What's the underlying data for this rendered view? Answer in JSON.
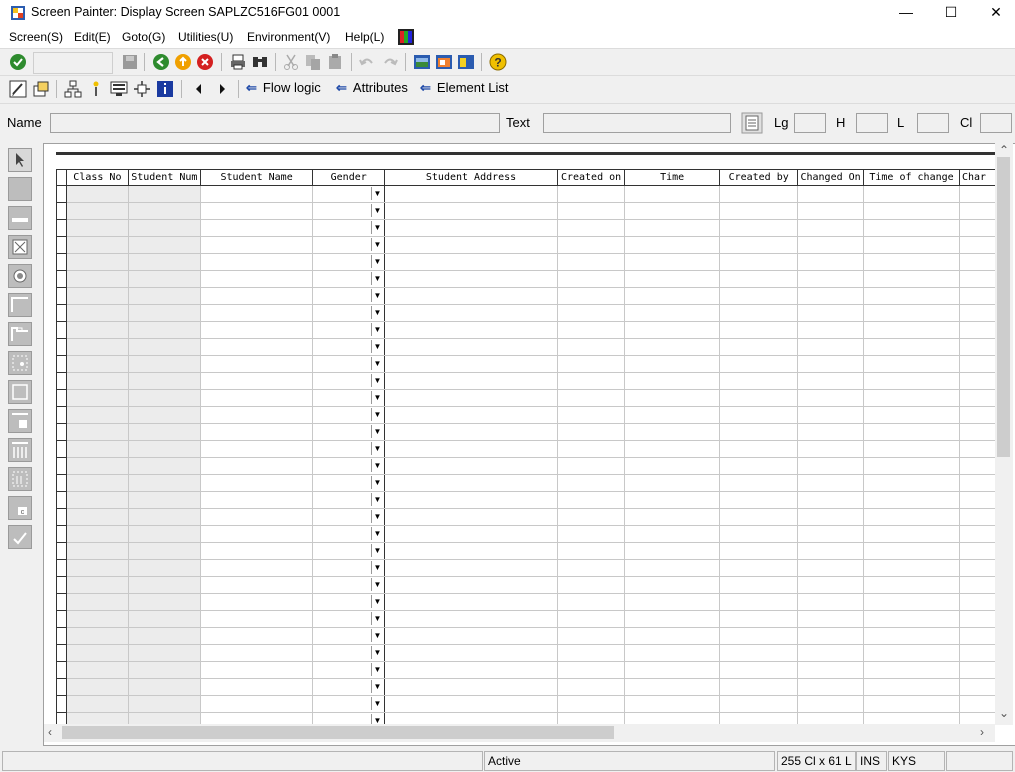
{
  "window": {
    "title": "Screen Painter:  Display Screen SAPLZC516FG01 0001",
    "minimize": "—",
    "maximize": "☐",
    "close": "✕"
  },
  "menu": [
    "Screen(S)",
    "Edit(E)",
    "Goto(G)",
    "Utilities(U)",
    "Environment(V)",
    "Help(L)"
  ],
  "nav": {
    "flow_logic": "Flow logic",
    "attributes": "Attributes",
    "element_list": "Element List"
  },
  "fields": {
    "name_label": "Name",
    "text_label": "Text",
    "lg_label": "Lg",
    "h_label": "H",
    "l_label": "L",
    "cl_label": "Cl"
  },
  "table": {
    "columns": [
      "Class No",
      "Student Num",
      "Student Name",
      "Gender",
      "Student Address",
      "Created on",
      "Time",
      "Created by",
      "Changed On",
      "Time of change",
      "Char"
    ],
    "row_count": 32
  },
  "status": {
    "state": "Active",
    "size": "255 Cl x 61 L",
    "mode": "INS",
    "keyboard": "KYS"
  },
  "colors": {
    "accent_blue": "#1f4aa8",
    "ok_green": "#2e8b2e",
    "cancel_red": "#d42020",
    "help_yellow": "#f0c000"
  }
}
